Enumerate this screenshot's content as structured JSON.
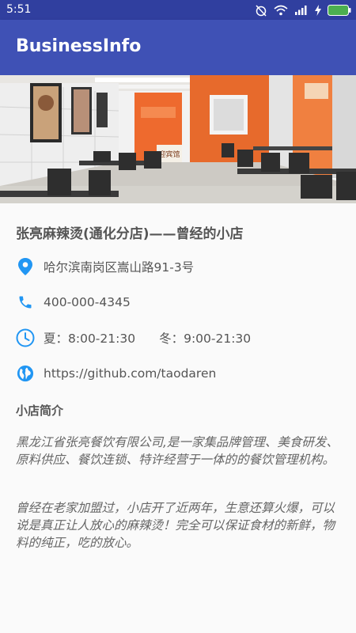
{
  "status_bar": {
    "time": "5:51"
  },
  "app_bar": {
    "title": "BusinessInfo"
  },
  "hero": {
    "sign_text": "迎宾馆"
  },
  "shop": {
    "title": "张亮麻辣烫(通化分店)——曾经的小店",
    "address": "哈尔滨南岗区嵩山路91-3号",
    "phone": "400-000-4345",
    "hours_summer": "夏：8:00-21:30",
    "hours_winter": "冬：9:00-21:30",
    "website": "https://github.com/taodaren"
  },
  "intro": {
    "section_title": "小店简介",
    "paragraph_1": "黑龙江省张亮餐饮有限公司,是一家集品牌管理、美食研发、原料供应、餐饮连锁、特许经营于一体的的餐饮管理机构。",
    "paragraph_2": "曾经在老家加盟过，小店开了近两年，生意还算火爆，可以说是真正让人放心的麻辣烫！完全可以保证食材的新鲜，物料的纯正，吃的放心。"
  },
  "colors": {
    "primary": "#3F51B5",
    "primary_dark": "#303F9F",
    "icon_blue": "#2196F3"
  },
  "icons": [
    "location-pin-icon",
    "phone-icon",
    "clock-icon",
    "globe-icon"
  ]
}
